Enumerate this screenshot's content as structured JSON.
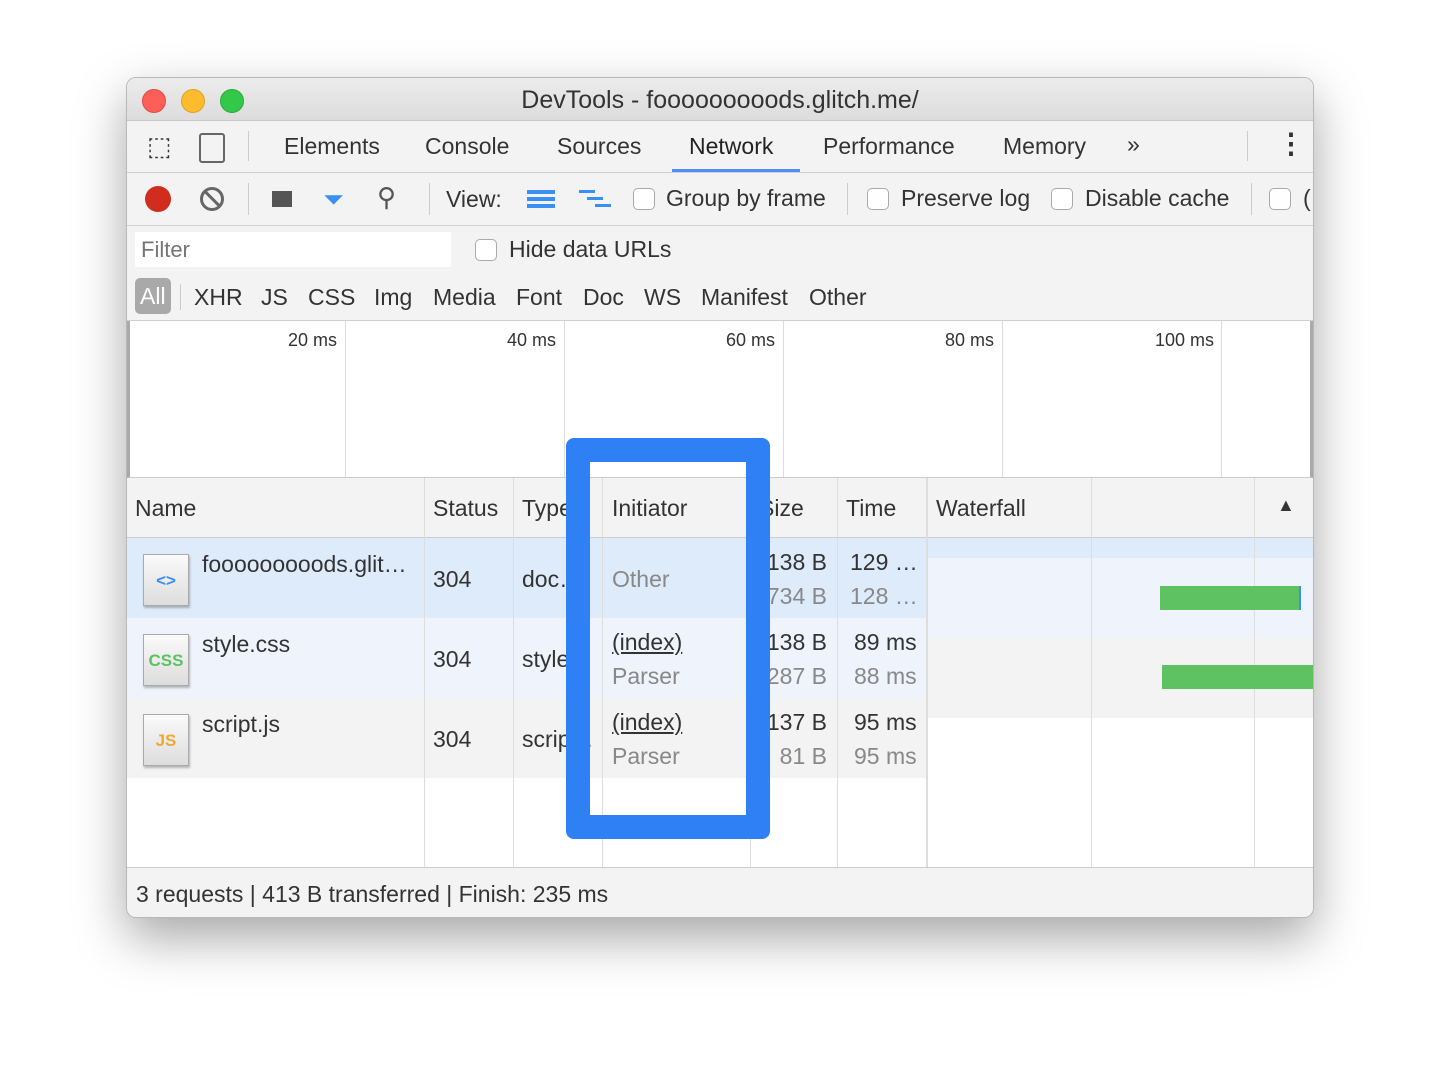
{
  "window": {
    "title": "DevTools - fooooooooods.glitch.me/"
  },
  "tabs": [
    {
      "label": "Elements"
    },
    {
      "label": "Console"
    },
    {
      "label": "Sources"
    },
    {
      "label": "Network",
      "active": true
    },
    {
      "label": "Performance"
    },
    {
      "label": "Memory"
    }
  ],
  "tabs_more": "»",
  "toolbar": {
    "view_label": "View:",
    "group_by_frame": "Group by frame",
    "preserve_log": "Preserve log",
    "disable_cache": "Disable cache",
    "offline_partial": "("
  },
  "filter": {
    "placeholder": "Filter",
    "hide_data_urls": "Hide data URLs"
  },
  "types": [
    "All",
    "XHR",
    "JS",
    "CSS",
    "Img",
    "Media",
    "Font",
    "Doc",
    "WS",
    "Manifest",
    "Other"
  ],
  "overview": {
    "ticks": [
      "20 ms",
      "40 ms",
      "60 ms",
      "80 ms",
      "100 ms"
    ]
  },
  "table": {
    "headers": {
      "name": "Name",
      "status": "Status",
      "type": "Type",
      "initiator": "Initiator",
      "size": "Size",
      "time": "Time",
      "waterfall": "Waterfall"
    },
    "rows": [
      {
        "name": "fooooooooods.glit…",
        "icon": "html",
        "status": "304",
        "type": "doc…",
        "initiator": "Other",
        "initiator_sub": "",
        "size": "138 B",
        "size_sub": "734 B",
        "time": "129 …",
        "time_sub": "128 …"
      },
      {
        "name": "style.css",
        "icon": "CSS",
        "status": "304",
        "type": "style…",
        "initiator": "(index)",
        "initiator_sub": "Parser",
        "size": "138 B",
        "size_sub": "287 B",
        "time": "89 ms",
        "time_sub": "88 ms"
      },
      {
        "name": "script.js",
        "icon": "JS",
        "status": "304",
        "type": "scrip…",
        "initiator": "(index)",
        "initiator_sub": "Parser",
        "size": "137 B",
        "size_sub": "81 B",
        "time": "95 ms",
        "time_sub": "95 ms"
      }
    ]
  },
  "footer": {
    "summary": "3 requests | 413 B transferred | Finish: 235 ms"
  },
  "colors": {
    "highlight": "#2f7ff5",
    "waterfall_bar": "#5ec262",
    "selected_row": "#deebfb",
    "record": "#d12c1e"
  }
}
